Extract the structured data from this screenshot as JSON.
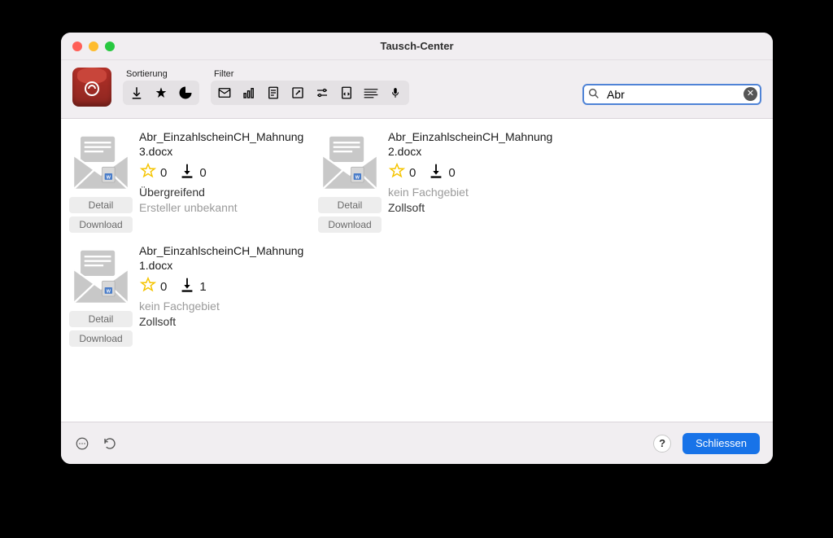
{
  "window": {
    "title": "Tausch-Center"
  },
  "toolbar": {
    "sort_label": "Sortierung",
    "filter_label": "Filter"
  },
  "search": {
    "value": "Abr"
  },
  "items": [
    {
      "filename": "Abr_EinzahlscheinCH_Mahnung3.docx",
      "stars": "0",
      "downloads": "0",
      "category": "Übergreifend",
      "author": "Ersteller unbekannt",
      "category_muted": false,
      "author_muted": true
    },
    {
      "filename": "Abr_EinzahlscheinCH_Mahnung2.docx",
      "stars": "0",
      "downloads": "0",
      "category": "kein Fachgebiet",
      "author": "Zollsoft",
      "category_muted": true,
      "author_muted": false
    },
    {
      "filename": "Abr_EinzahlscheinCH_Mahnung1.docx",
      "stars": "0",
      "downloads": "1",
      "category": "kein Fachgebiet",
      "author": "Zollsoft",
      "category_muted": true,
      "author_muted": false
    }
  ],
  "buttons": {
    "detail": "Detail",
    "download": "Download",
    "close": "Schliessen",
    "help": "?"
  }
}
